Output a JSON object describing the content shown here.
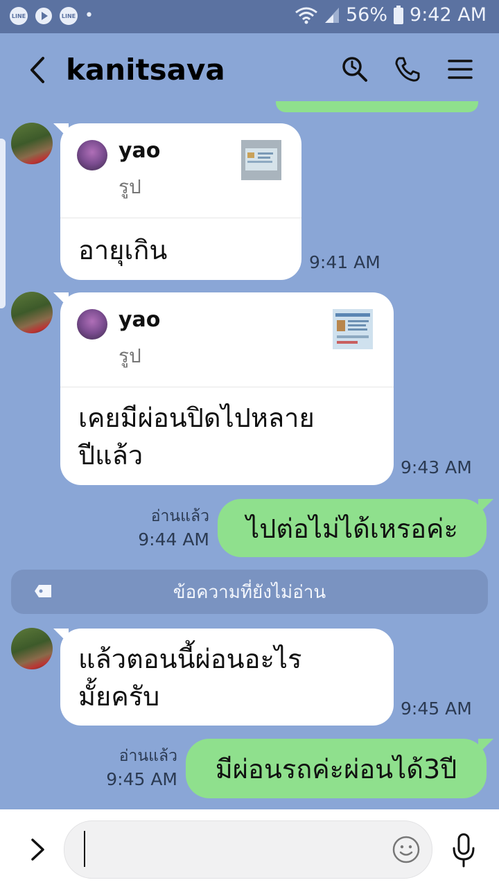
{
  "status_bar": {
    "apps": [
      "LINE",
      "LINE"
    ],
    "dot": "•",
    "battery": "56%",
    "clock": "9:42 AM"
  },
  "header": {
    "title": "kanitsava",
    "icons": [
      "back-icon",
      "search-icon",
      "phone-icon",
      "menu-icon"
    ]
  },
  "messages": [
    {
      "side": "left",
      "reply": {
        "name": "yao",
        "type": "รูป"
      },
      "text": "อายุเกิน",
      "time": "9:41 AM"
    },
    {
      "side": "left",
      "reply": {
        "name": "yao",
        "type": "รูป"
      },
      "text_lines": [
        "เคยมีผ่อนปิดไปหลาย",
        "ปีแล้ว"
      ],
      "time": "9:43 AM"
    },
    {
      "side": "right",
      "read": "อ่านแล้ว",
      "time": "9:44 AM",
      "text": "ไปต่อไม่ได้เหรอค่ะ"
    },
    {
      "side": "left",
      "text_lines": [
        "แล้วตอนนี้ผ่อนอะไร",
        "มั้ยครับ"
      ],
      "time": "9:45 AM"
    },
    {
      "side": "right",
      "read": "อ่านแล้ว",
      "time": "9:45 AM",
      "text": "มีผ่อนรถค่ะผ่อนได้3ปี"
    }
  ],
  "unread_divider": "ข้อความที่ยังไม่อ่าน",
  "input": {
    "value": "",
    "icons": [
      "expand-icon",
      "emoji-icon",
      "mic-icon"
    ]
  },
  "colors": {
    "background": "#8aa6d6",
    "status_bar": "#5b72a1",
    "my_bubble": "#8fe08d",
    "their_bubble": "#ffffff"
  }
}
